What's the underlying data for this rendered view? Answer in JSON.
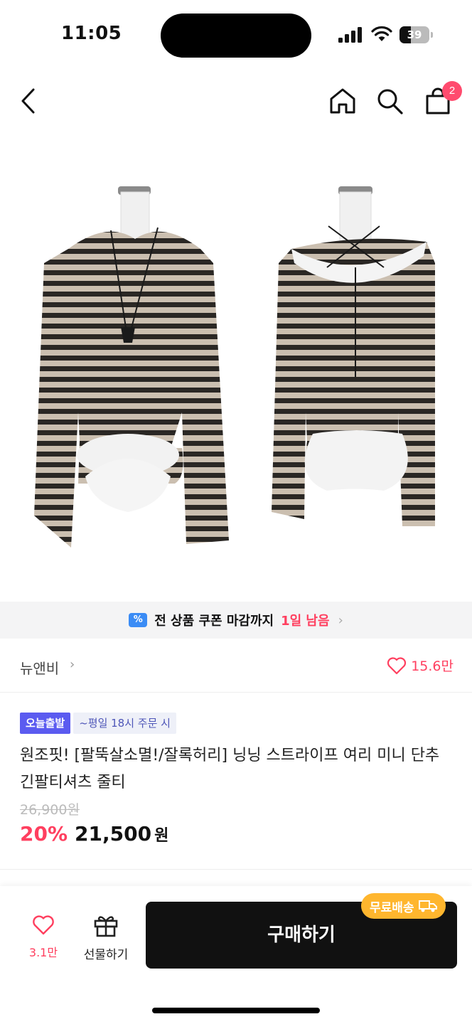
{
  "status_bar": {
    "time": "11:05",
    "battery": "39",
    "battery_level": 0.39
  },
  "nav": {
    "back_icon": "chevron-left-icon",
    "home_icon": "home-icon",
    "search_icon": "search-icon",
    "cart_icon": "shopping-bag-icon",
    "cart_count": "2"
  },
  "coupon_banner": {
    "icon": "coupon-icon",
    "icon_text": "%",
    "text": "전 상품 쿠폰 마감까지",
    "highlight": "1일 남음",
    "chevron": "›"
  },
  "brand": {
    "name": "뉴앤비",
    "chevron": "›",
    "likes": "15.6만"
  },
  "product": {
    "badge_today": "오늘출발",
    "badge_time": "~평일 18시 주문 시",
    "title": "원조핏! [팔뚝살소멸!/잘록허리] 닝닝 스트라이프 여리 미니 단추 긴팔티셔츠 줄티",
    "original_price": "26,900원",
    "discount": "20%",
    "price": "21,500",
    "price_unit": "원"
  },
  "bottom_bar": {
    "like_count": "3.1만",
    "gift_label": "선물하기",
    "buy_label": "구매하기",
    "free_shipping": "무료배송"
  },
  "colors": {
    "accent": "#ff3f5f",
    "badge_blue": "#5b5bf0",
    "shipping": "#ffb62e"
  }
}
